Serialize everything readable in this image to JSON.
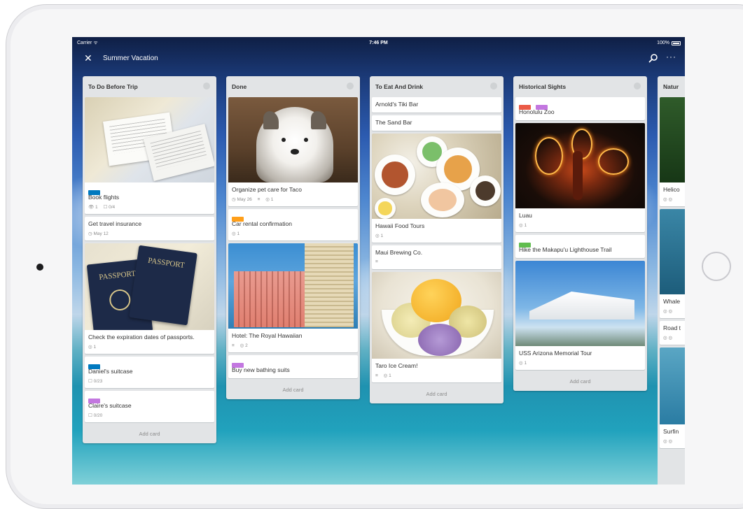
{
  "statusbar": {
    "carrier": "Carrier ᯤ",
    "time": "7:46 PM",
    "battery": "100%"
  },
  "board": {
    "title": "Summer Vacation"
  },
  "icons": {
    "close": "close-icon",
    "search": "search-icon",
    "more": "more-icon"
  },
  "lists": [
    {
      "title": "To Do Before Trip",
      "cards": [
        {
          "image": "flight-tickets",
          "labels": [
            "#0079bf"
          ],
          "title": "Book flights",
          "badges": [
            "👁 1",
            "☐ 0/4"
          ]
        },
        {
          "title": "Get travel insurance",
          "badges": [
            "◷ May 12"
          ]
        },
        {
          "image": "passports",
          "title": "Check the expiration dates of passports.",
          "badges": [
            "◎ 1"
          ]
        },
        {
          "labels": [
            "#0079bf"
          ],
          "title": "Daniel's suitcase",
          "badges": [
            "☐ 0/23"
          ]
        },
        {
          "labels": [
            "#c377e0"
          ],
          "title": "Claire's suitcase",
          "badges": [
            "☐ 0/20"
          ]
        }
      ],
      "add_card": "Add card"
    },
    {
      "title": "Done",
      "cards": [
        {
          "image": "puppy",
          "title": "Organize pet care for Taco",
          "badges": [
            "◷ May 26",
            "≡",
            "◎ 1"
          ]
        },
        {
          "labels": [
            "#ff9f1a"
          ],
          "title": "Car rental confirmation",
          "badges": [
            "◎ 1"
          ]
        },
        {
          "image": "hotel",
          "title": "Hotel: The Royal Hawaiian",
          "badges": [
            "≡",
            "◎ 2"
          ]
        },
        {
          "labels": [
            "#c377e0"
          ],
          "title": "Buy new bathing suits",
          "badges": []
        }
      ],
      "add_card": "Add card"
    },
    {
      "title": "To Eat And Drink",
      "cards": [
        {
          "title": "Arnold's Tiki Bar",
          "badges": []
        },
        {
          "title": "The Sand Bar",
          "badges": []
        },
        {
          "image": "hawaii-food",
          "title": "Hawaii Food Tours",
          "badges": [
            "◎ 1"
          ]
        },
        {
          "title": "Maui Brewing Co.",
          "badges": [
            "≡"
          ]
        },
        {
          "image": "ice-cream",
          "title": "Taro Ice Cream!",
          "badges": [
            "≡",
            "◎ 1"
          ]
        }
      ],
      "add_card": "Add card"
    },
    {
      "title": "Historical Sights",
      "cards": [
        {
          "labels": [
            "#eb5a46",
            "#c377e0"
          ],
          "title": "Honolulu Zoo",
          "badges": []
        },
        {
          "image": "fire-dancer",
          "title": "Luau",
          "badges": [
            "◎ 1"
          ]
        },
        {
          "labels": [
            "#61bd4f"
          ],
          "title": "Hike the Makapu'u Lighthouse Trail",
          "badges": []
        },
        {
          "image": "memorial",
          "title": "USS Arizona Memorial Tour",
          "badges": [
            "◎ 1"
          ]
        }
      ],
      "add_card": "Add card"
    }
  ],
  "partial_list": {
    "title": "Natur",
    "cards": [
      "Helico",
      "Whale",
      "Road t",
      "Surfin"
    ]
  },
  "colors": {
    "board_bg": "#2c5bb0",
    "list_bg": "#e2e4e6",
    "header_text": "#ffffff"
  }
}
